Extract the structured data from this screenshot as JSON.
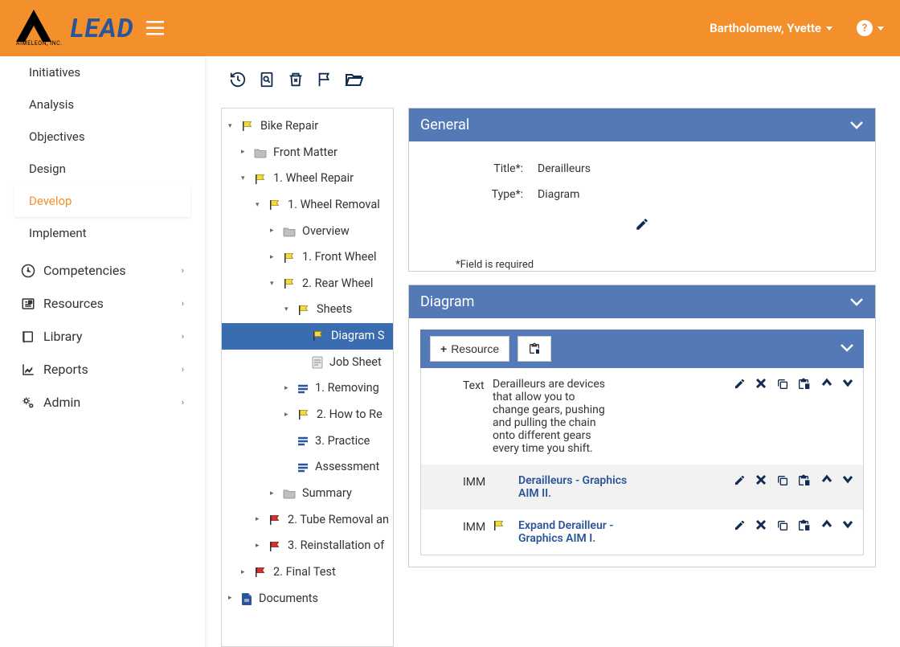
{
  "header": {
    "brand_inc": "AIMELEON, INC.",
    "brand": "LEAD",
    "user": "Bartholomew, Yvette"
  },
  "sidebar": {
    "items": [
      {
        "label": "Initiatives"
      },
      {
        "label": "Analysis"
      },
      {
        "label": "Objectives"
      },
      {
        "label": "Design"
      },
      {
        "label": "Develop"
      },
      {
        "label": "Implement"
      }
    ],
    "sections": [
      {
        "label": "Competencies",
        "icon": "dashboard-icon"
      },
      {
        "label": "Resources",
        "icon": "news-icon"
      },
      {
        "label": "Library",
        "icon": "book-icon"
      },
      {
        "label": "Reports",
        "icon": "chart-icon"
      },
      {
        "label": "Admin",
        "icon": "gears-icon"
      }
    ]
  },
  "tree": [
    {
      "indent": 0,
      "icon": "flag-yellow",
      "label": "Bike Repair",
      "toggle": "down"
    },
    {
      "indent": 1,
      "icon": "folder",
      "label": "Front Matter",
      "toggle": "right"
    },
    {
      "indent": 1,
      "icon": "flag-yellow",
      "label": "1. Wheel Repair",
      "toggle": "down"
    },
    {
      "indent": 2,
      "icon": "flag-yellow",
      "label": "1. Wheel Removal",
      "toggle": "down"
    },
    {
      "indent": 3,
      "icon": "folder",
      "label": "Overview",
      "toggle": "right"
    },
    {
      "indent": 3,
      "icon": "flag-yellow",
      "label": "1. Front Wheel",
      "toggle": "right"
    },
    {
      "indent": 3,
      "icon": "flag-yellow",
      "label": "2. Rear Wheel",
      "toggle": "down"
    },
    {
      "indent": 4,
      "icon": "flag-yellow",
      "label": "Sheets",
      "toggle": "down"
    },
    {
      "indent": 5,
      "icon": "flag-yellow",
      "label": "Diagram S",
      "selected": true
    },
    {
      "indent": 5,
      "icon": "doc",
      "label": "Job Sheet"
    },
    {
      "indent": 4,
      "icon": "lines",
      "label": "1. Removing",
      "toggle": "right"
    },
    {
      "indent": 4,
      "icon": "flag-yellow",
      "label": "2. How to Re",
      "toggle": "right"
    },
    {
      "indent": 4,
      "icon": "lines",
      "label": "3. Practice"
    },
    {
      "indent": 4,
      "icon": "lines",
      "label": "Assessment"
    },
    {
      "indent": 3,
      "icon": "folder",
      "label": "Summary",
      "toggle": "right"
    },
    {
      "indent": 2,
      "icon": "flag-red",
      "label": "2. Tube Removal an",
      "toggle": "right"
    },
    {
      "indent": 2,
      "icon": "flag-red",
      "label": "3. Reinstallation of",
      "toggle": "right"
    },
    {
      "indent": 1,
      "icon": "flag-red",
      "label": "2. Final Test",
      "toggle": "right"
    },
    {
      "indent": 0,
      "icon": "page",
      "label": "Documents",
      "toggle": "right"
    }
  ],
  "general": {
    "title": "General",
    "fields": [
      {
        "label": "Title*:",
        "value": "Derailleurs"
      },
      {
        "label": "Type*:",
        "value": "Diagram"
      }
    ],
    "required_note": "*Field is required"
  },
  "diagram": {
    "title": "Diagram",
    "resource_label": "Resource",
    "rows": [
      {
        "type": "Text",
        "content": "Derailleurs are devices that allow you to change gears, pushing and pulling the chain onto different gears every time you shift.",
        "link": false,
        "alt": false
      },
      {
        "type": "IMM",
        "content": "Derailleurs - Graphics AIM II.",
        "link": true,
        "alt": true
      },
      {
        "type": "IMM",
        "content": "Expand Derailleur - Graphics AIM I.",
        "link": true,
        "flag": true,
        "alt": false
      }
    ]
  }
}
